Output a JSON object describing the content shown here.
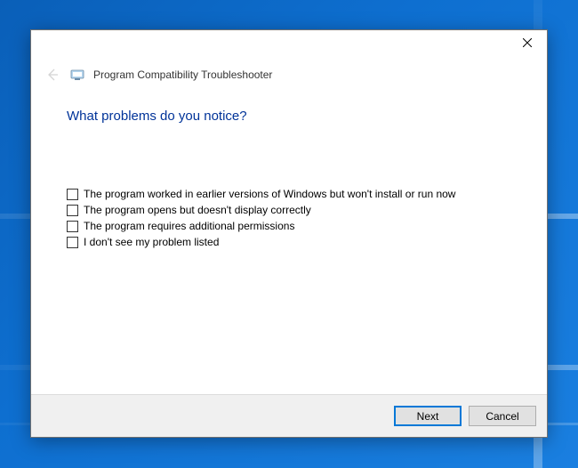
{
  "dialog": {
    "title": "Program Compatibility Troubleshooter",
    "heading": "What problems do you notice?"
  },
  "options": [
    {
      "label": "The program worked in earlier versions of Windows but won't install or run now",
      "checked": false
    },
    {
      "label": "The program opens but doesn't display correctly",
      "checked": false
    },
    {
      "label": "The program requires additional permissions",
      "checked": false
    },
    {
      "label": "I don't see my problem listed",
      "checked": false
    }
  ],
  "buttons": {
    "next": "Next",
    "cancel": "Cancel"
  }
}
